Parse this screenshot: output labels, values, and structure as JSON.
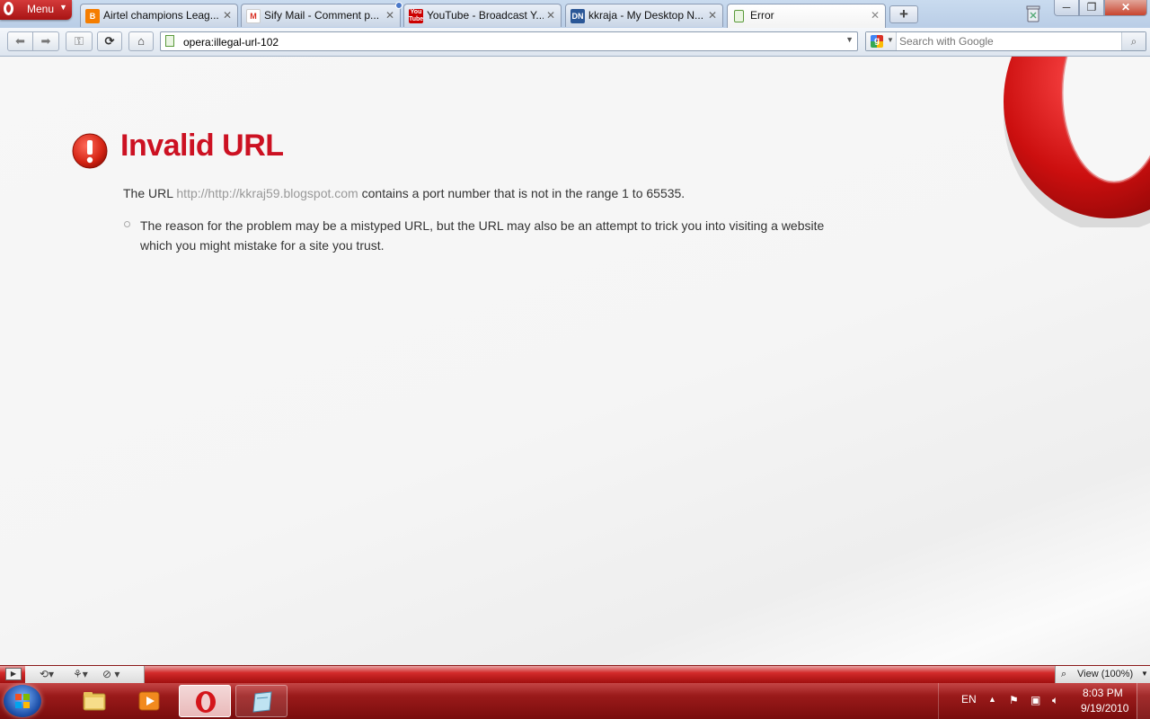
{
  "browser": {
    "menu_label": "Menu",
    "tabs": [
      {
        "title": "Airtel champions Leag...",
        "icon": "blogger-icon",
        "color": "#f57d00"
      },
      {
        "title": "Sify Mail - Comment p...",
        "icon": "gmail-icon",
        "color": "#d93025"
      },
      {
        "title": "YouTube - Broadcast Y...",
        "icon": "youtube-icon",
        "color": "#cc0000"
      },
      {
        "title": "kkraja - My Desktop N...",
        "icon": "dn-icon",
        "color": "#2b5797"
      },
      {
        "title": "Error",
        "icon": "page-icon",
        "active": true
      }
    ],
    "address": "opera:illegal-url-102",
    "search_placeholder": "Search with Google"
  },
  "page": {
    "title": "Invalid URL",
    "message_before": "The URL ",
    "message_url": "http://http://kkraj59.blogspot.com",
    "message_after": " contains a port number that is not in the range 1 to 65535.",
    "reason": "The reason for the problem may be a mistyped URL, but the URL may also be an attempt to trick you into visiting a website which you might mistake for a site you trust."
  },
  "statusbar": {
    "view_label": "View (100%)"
  },
  "taskbar": {
    "language": "EN",
    "time": "8:03 PM",
    "date": "9/19/2010"
  },
  "colors": {
    "accent_red": "#cc1122",
    "taskbar_red": "#9a1a1a"
  }
}
